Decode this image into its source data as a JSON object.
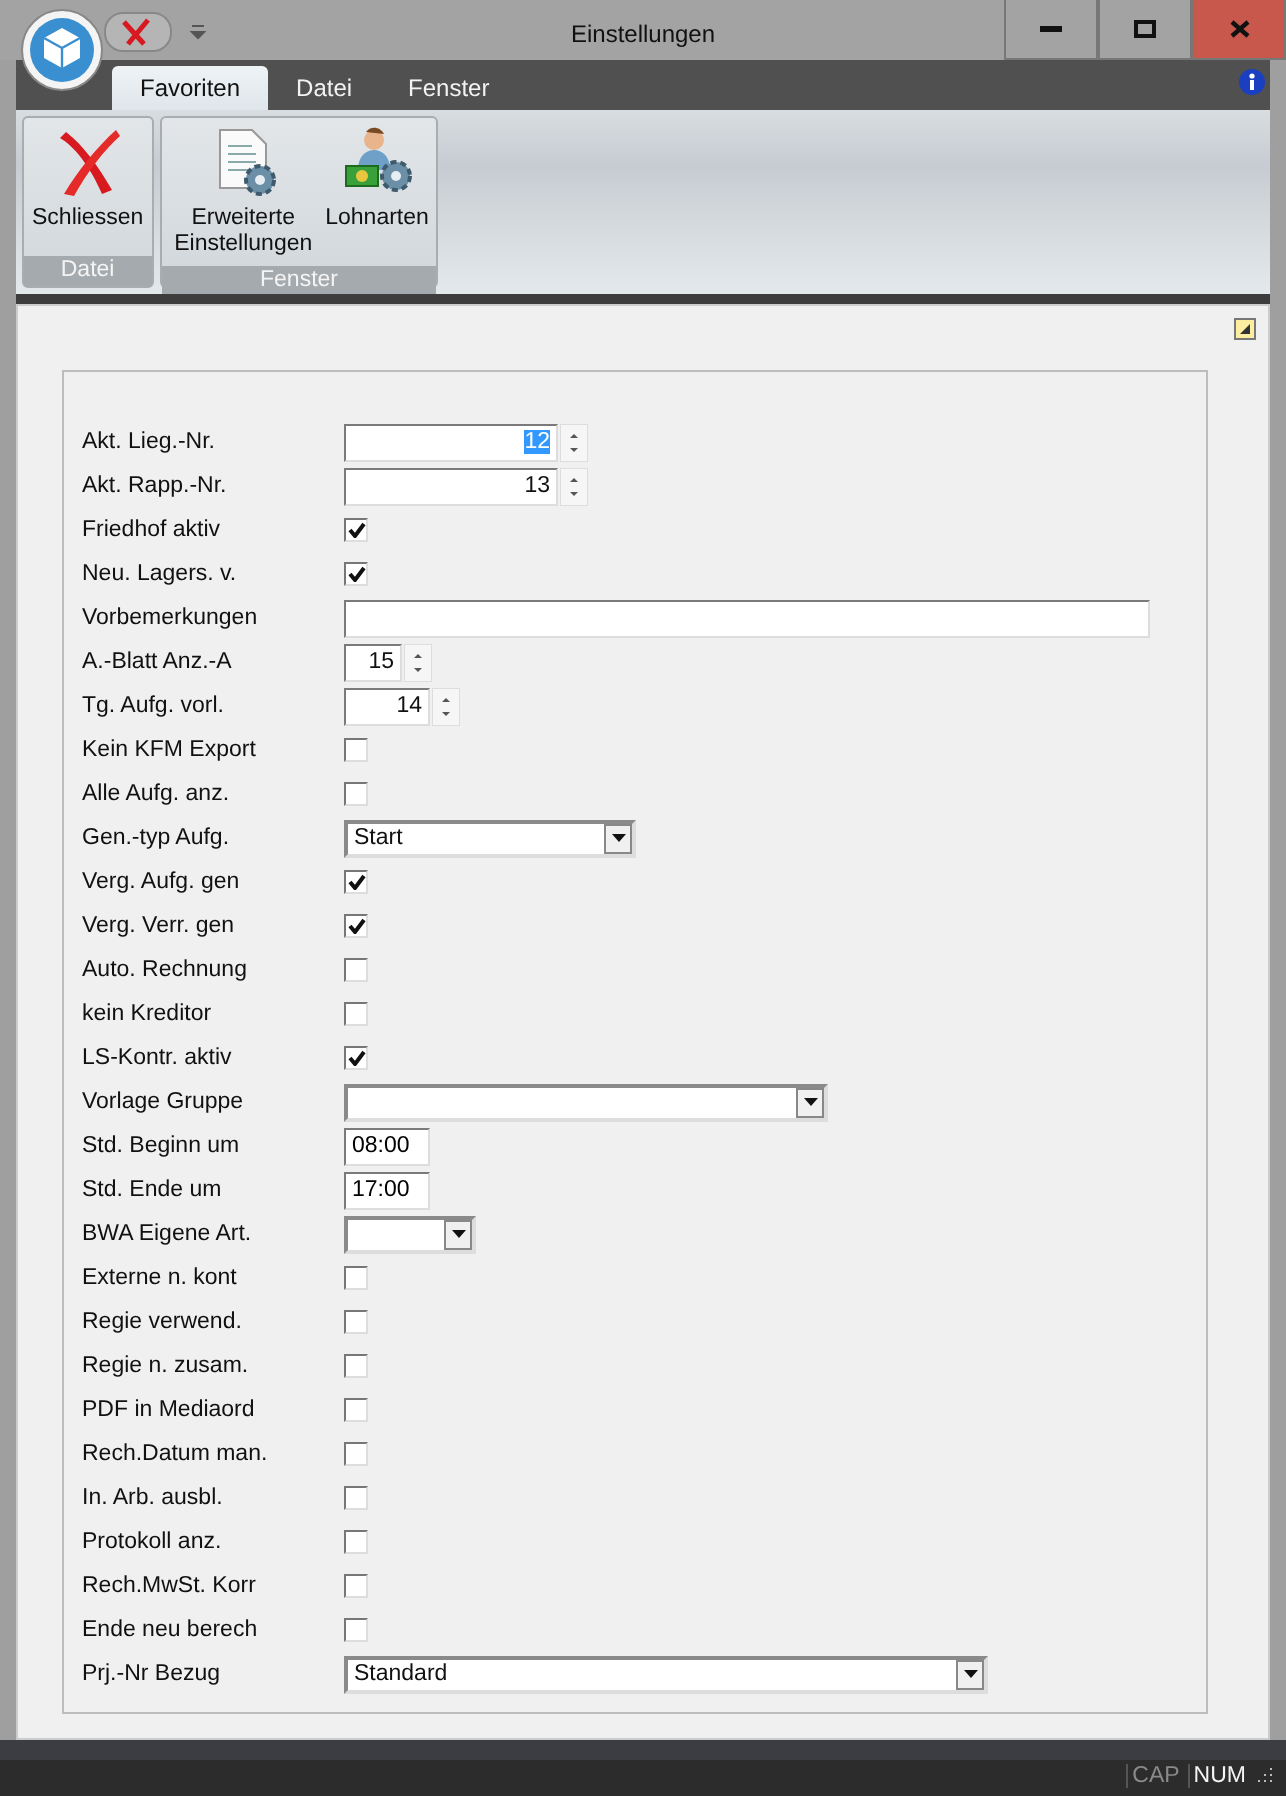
{
  "window": {
    "title": "Einstellungen"
  },
  "tabs": [
    {
      "label": "Favoriten",
      "selected": true
    },
    {
      "label": "Datei",
      "selected": false
    },
    {
      "label": "Fenster",
      "selected": false
    }
  ],
  "ribbon_groups": [
    {
      "label": "Datei",
      "buttons": [
        {
          "label": "Schliessen",
          "kind": "close"
        }
      ]
    },
    {
      "label": "Fenster",
      "buttons": [
        {
          "label": "Erweiterte Einstellungen",
          "kind": "settings"
        },
        {
          "label": "Lohnarten",
          "kind": "wages"
        }
      ]
    }
  ],
  "fields": [
    {
      "label": "Akt. Lieg.-Nr.",
      "kind": "spinner",
      "value": "12",
      "selected": true
    },
    {
      "label": "Akt. Rapp.-Nr.",
      "kind": "spinner",
      "value": "13",
      "selected": false
    },
    {
      "label": "Friedhof aktiv",
      "kind": "checkbox",
      "checked": true
    },
    {
      "label": "Neu. Lagers. v.",
      "kind": "checkbox",
      "checked": true
    },
    {
      "label": "Vorbemerkungen",
      "kind": "text"
    },
    {
      "label": "A.-Blatt Anz.-A",
      "kind": "spinner",
      "value": "15",
      "selected": false
    },
    {
      "label": "Tg. Aufg. vorl.",
      "kind": "spinner",
      "value": "14",
      "selected": false
    },
    {
      "label": "Kein KFM Export",
      "kind": "checkbox",
      "checked": false
    },
    {
      "label": "Alle Aufg. anz.",
      "kind": "checkbox",
      "checked": false
    },
    {
      "label": "Gen.-typ Aufg.",
      "kind": "combo",
      "value": "Start"
    },
    {
      "label": "Verg. Aufg. gen",
      "kind": "checkbox",
      "checked": true
    },
    {
      "label": "Verg. Verr. gen",
      "kind": "checkbox",
      "checked": true
    },
    {
      "label": "Auto. Rechnung",
      "kind": "checkbox",
      "checked": false
    },
    {
      "label": "kein Kreditor",
      "kind": "checkbox",
      "checked": false
    },
    {
      "label": "LS-Kontr. aktiv",
      "kind": "checkbox",
      "checked": true
    },
    {
      "label": "Vorlage Gruppe",
      "kind": "combo"
    },
    {
      "label": "Std. Beginn um",
      "kind": "text",
      "value": "08:00"
    },
    {
      "label": "Std. Ende um",
      "kind": "text",
      "value": "17:00"
    },
    {
      "label": "BWA Eigene Art.",
      "kind": "combo"
    },
    {
      "label": "Externe n. kont",
      "kind": "checkbox",
      "checked": false
    },
    {
      "label": "Regie verwend.",
      "kind": "checkbox",
      "checked": false
    },
    {
      "label": "Regie n. zusam.",
      "kind": "checkbox",
      "checked": false
    },
    {
      "label": "PDF in Mediaord",
      "kind": "checkbox",
      "checked": false
    },
    {
      "label": "Rech.Datum man.",
      "kind": "checkbox",
      "checked": false
    },
    {
      "label": "In. Arb. ausbl.",
      "kind": "checkbox",
      "checked": false
    },
    {
      "label": "Protokoll anz.",
      "kind": "checkbox",
      "checked": false
    },
    {
      "label": "Rech.MwSt. Korr",
      "kind": "checkbox",
      "checked": false
    },
    {
      "label": "Ende neu berech",
      "kind": "checkbox",
      "checked": false
    },
    {
      "label": "Prj.-Nr Bezug",
      "kind": "combo",
      "value": "Standard"
    }
  ],
  "status_bar": [
    {
      "label": "CAP",
      "on": false
    },
    {
      "label": "NUM",
      "on": true
    }
  ]
}
